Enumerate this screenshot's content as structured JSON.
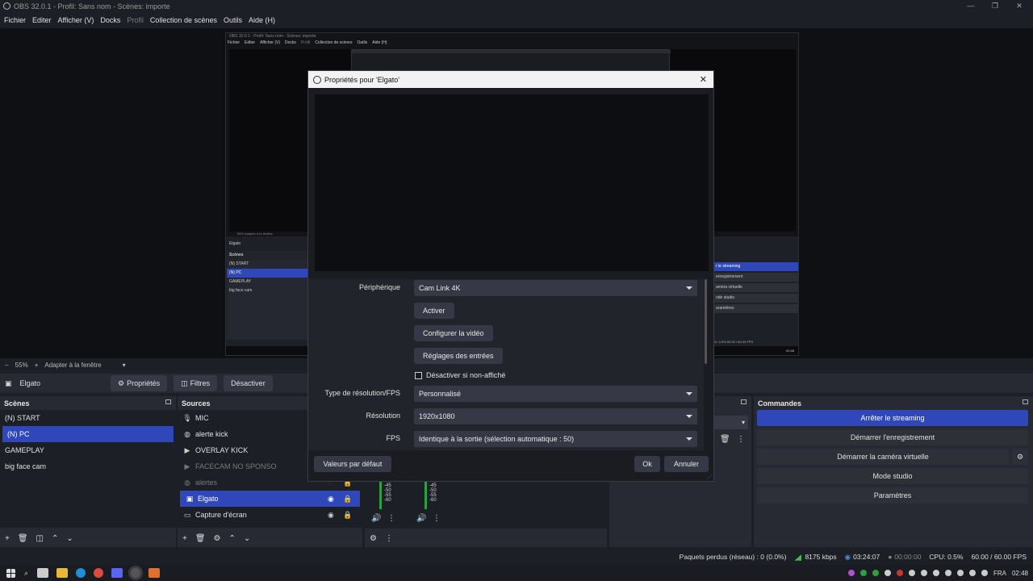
{
  "window": {
    "title": "OBS 32.0.1 - Profil: Sans nom - Scènes: importe",
    "minimize_icon": "—",
    "maximize_icon": "❐",
    "close_icon": "✕"
  },
  "menu": [
    "Fichier",
    "Editer",
    "Afficher (V)",
    "Docks",
    "Profil",
    "Collection de scènes",
    "Outils",
    "Aide (H)"
  ],
  "zoom": {
    "value": "55%",
    "mode": "Adapter à la fenêtre"
  },
  "source_toolbar": {
    "source_name": "Elgato",
    "properties": "Propriétés",
    "filters": "Filtres",
    "deactivate": "Désactiver"
  },
  "scenes": {
    "title": "Scènes",
    "items": [
      "(N) START",
      "(N) PC",
      "GAMEPLAY",
      "big face cam"
    ],
    "selected": "(N) PC"
  },
  "sources": {
    "title": "Sources",
    "items": [
      {
        "name": "MIC",
        "icon": "mic-icon"
      },
      {
        "name": "alerte kick",
        "icon": "globe-icon"
      },
      {
        "name": "OVERLAY KICK",
        "icon": "play-icon"
      },
      {
        "name": "FACECAM NO SPONSO",
        "icon": "play-icon",
        "dim": true
      },
      {
        "name": "alertes",
        "icon": "globe-icon",
        "dim": true
      },
      {
        "name": "Elgato",
        "icon": "camera-icon",
        "selected": true
      },
      {
        "name": "Capture d'écran",
        "icon": "monitor-icon"
      }
    ]
  },
  "mixer": {
    "scale": [
      "-40",
      "-45",
      "-50",
      "-55",
      "-60"
    ]
  },
  "commands": {
    "title": "Commandes",
    "buttons": [
      "Arrêter le streaming",
      "Démarrer l'enregistrement",
      "Démarrer la caméra virtuelle",
      "Mode studio",
      "Paramètres"
    ]
  },
  "status": {
    "dropped": "Paquets perdus (réseau) : 0 (0.0%)",
    "bitrate": "8175 kbps",
    "stream_time": "03:24:07",
    "rec_time": "00:00:00",
    "cpu": "CPU: 0.5%",
    "fps": "60.00 / 60.00 FPS"
  },
  "taskbar": {
    "lang": "FRA",
    "time": "02:48"
  },
  "dialog": {
    "title": "Propriétés pour 'Elgato'",
    "device_label": "Périphérique",
    "device_value": "Cam Link 4K",
    "activate": "Activer",
    "configure_video": "Configurer la vidéo",
    "input_settings": "Réglages des entrées",
    "deactivate_hidden": "Désactiver si non-affiché",
    "res_type_label": "Type de résolution/FPS",
    "res_type_value": "Personnalisé",
    "resolution_label": "Résolution",
    "resolution_value": "1920x1080",
    "fps_label": "FPS",
    "fps_value": "Identique à la sortie (sélection automatique : 50)",
    "defaults": "Valeurs par défaut",
    "ok": "Ok",
    "cancel": "Annuler"
  },
  "nested_preview": {
    "title": "OBS 32.0.1 - Profil: Sans nom - Scènes: importe",
    "menu": [
      "Fichier",
      "Editer",
      "Afficher (V)",
      "Docks",
      "Profil",
      "Collection de scènes",
      "Outils",
      "Aide (H)"
    ],
    "zoom": "55%   Adapter à la fenêtre",
    "source": "Elgato",
    "scenes_title": "Scènes",
    "scenes": [
      "(N) START",
      "(N) PC",
      "GAMEPLAY",
      "big face cam"
    ],
    "cmds": [
      "r le streaming",
      "enregistrement",
      "améra virtuelle",
      "ode studio",
      "aramètres"
    ],
    "status": "CPU: 0.5%   60.00 / 60.00 FPS",
    "time": "02:48"
  },
  "colors": {
    "accent": "#2f47b9",
    "bg": "#1d1f26",
    "panel": "#272a33"
  }
}
